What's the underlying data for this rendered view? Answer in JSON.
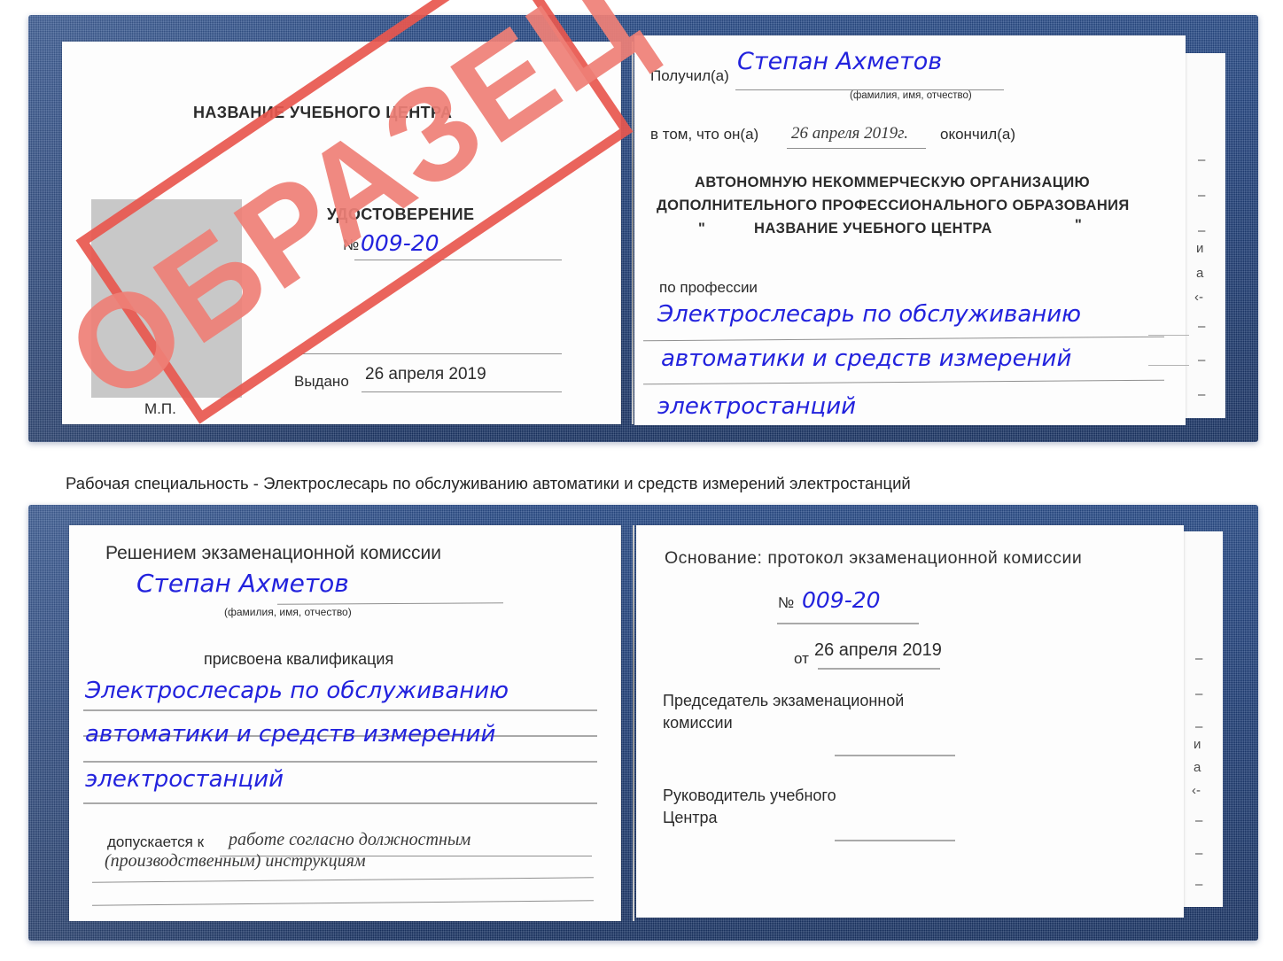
{
  "document": {
    "kind": "Russian vocational training certificate (удостоверение) — two spreads"
  },
  "colors": {
    "cover_blue": "#20407a",
    "handwriting_blue": "#2222dd",
    "stamp_red": "#e8574e",
    "stamp_text_red": "#ef8077",
    "page_white": "#fdfdfd",
    "rule_gray": "#8f8f8f",
    "photo_gray": "#c8c8c8"
  },
  "stamp": {
    "label": "ОБРАЗЕЦ",
    "icon": "sample-watermark"
  },
  "certificate_top": {
    "left_page": {
      "center_title": "НАЗВАНИЕ УЧЕБНОГО ЦЕНТРА",
      "doc_type": "УДОСТОВЕРЕНИЕ",
      "number_label": "№",
      "number_value": "009-20",
      "issued_label": "Выдано",
      "issued_value": "26 апреля 2019",
      "stamp_place_label": "М.П.",
      "photo_placeholder": "photo-placeholder"
    },
    "right_page": {
      "received_label": "Получил(а)",
      "received_value": "Степан Ахметов",
      "received_hint": "(фамилия, имя, отчество)",
      "that_he_label": "в том, что он(а)",
      "that_he_value": "26 апреля 2019г.",
      "finished_label": "окончил(а)",
      "org_line_1": "АВТОНОМНУЮ НЕКОММЕРЧЕСКУЮ ОРГАНИЗАЦИЮ",
      "org_line_2": "ДОПОЛНИТЕЛЬНОГО ПРОФЕССИОНАЛЬНОГО ОБРАЗОВАНИЯ",
      "org_quote_open": "\"",
      "org_line_3": "НАЗВАНИЕ УЧЕБНОГО ЦЕНТРА",
      "org_quote_close": "\"",
      "profession_label": "по профессии",
      "profession_line_1": "Электрослесарь по обслуживанию",
      "profession_line_2": "автоматики и средств измерений",
      "profession_line_3": "электростанций",
      "edge_fragments": [
        "–",
        "–",
        "–",
        "и",
        "а",
        "‹-",
        "–",
        "–",
        "–"
      ]
    }
  },
  "caption": {
    "text": "Рабочая специальность - Электрослесарь по обслуживанию автоматики и средств измерений электростанций"
  },
  "certificate_bottom": {
    "left_page": {
      "heading": "Решением экзаменационной комиссии",
      "name_value": "Степан Ахметов",
      "name_hint": "(фамилия, имя, отчество)",
      "qualification_label": "присвоена квалификация",
      "qualification_line_1": "Электрослесарь по обслуживанию",
      "qualification_line_2": "автоматики и средств измерений",
      "qualification_line_3": "электростанций",
      "admitted_label": "допускается к",
      "admitted_value_1": "работе согласно должностным",
      "admitted_value_2": "(производственным) инструкциям"
    },
    "right_page": {
      "basis_label": "Основание: протокол экзаменационной комиссии",
      "protocol_number_label": "№",
      "protocol_number_value": "009-20",
      "protocol_date_label": "от",
      "protocol_date_value": "26 апреля 2019",
      "chairman_line_1": "Председатель экзаменационной",
      "chairman_line_2": "комиссии",
      "head_line_1": "Руководитель учебного",
      "head_line_2": "Центра",
      "edge_fragments": [
        "–",
        "–",
        "–",
        "и",
        "а",
        "‹-",
        "–",
        "–",
        "–",
        "–"
      ]
    }
  }
}
